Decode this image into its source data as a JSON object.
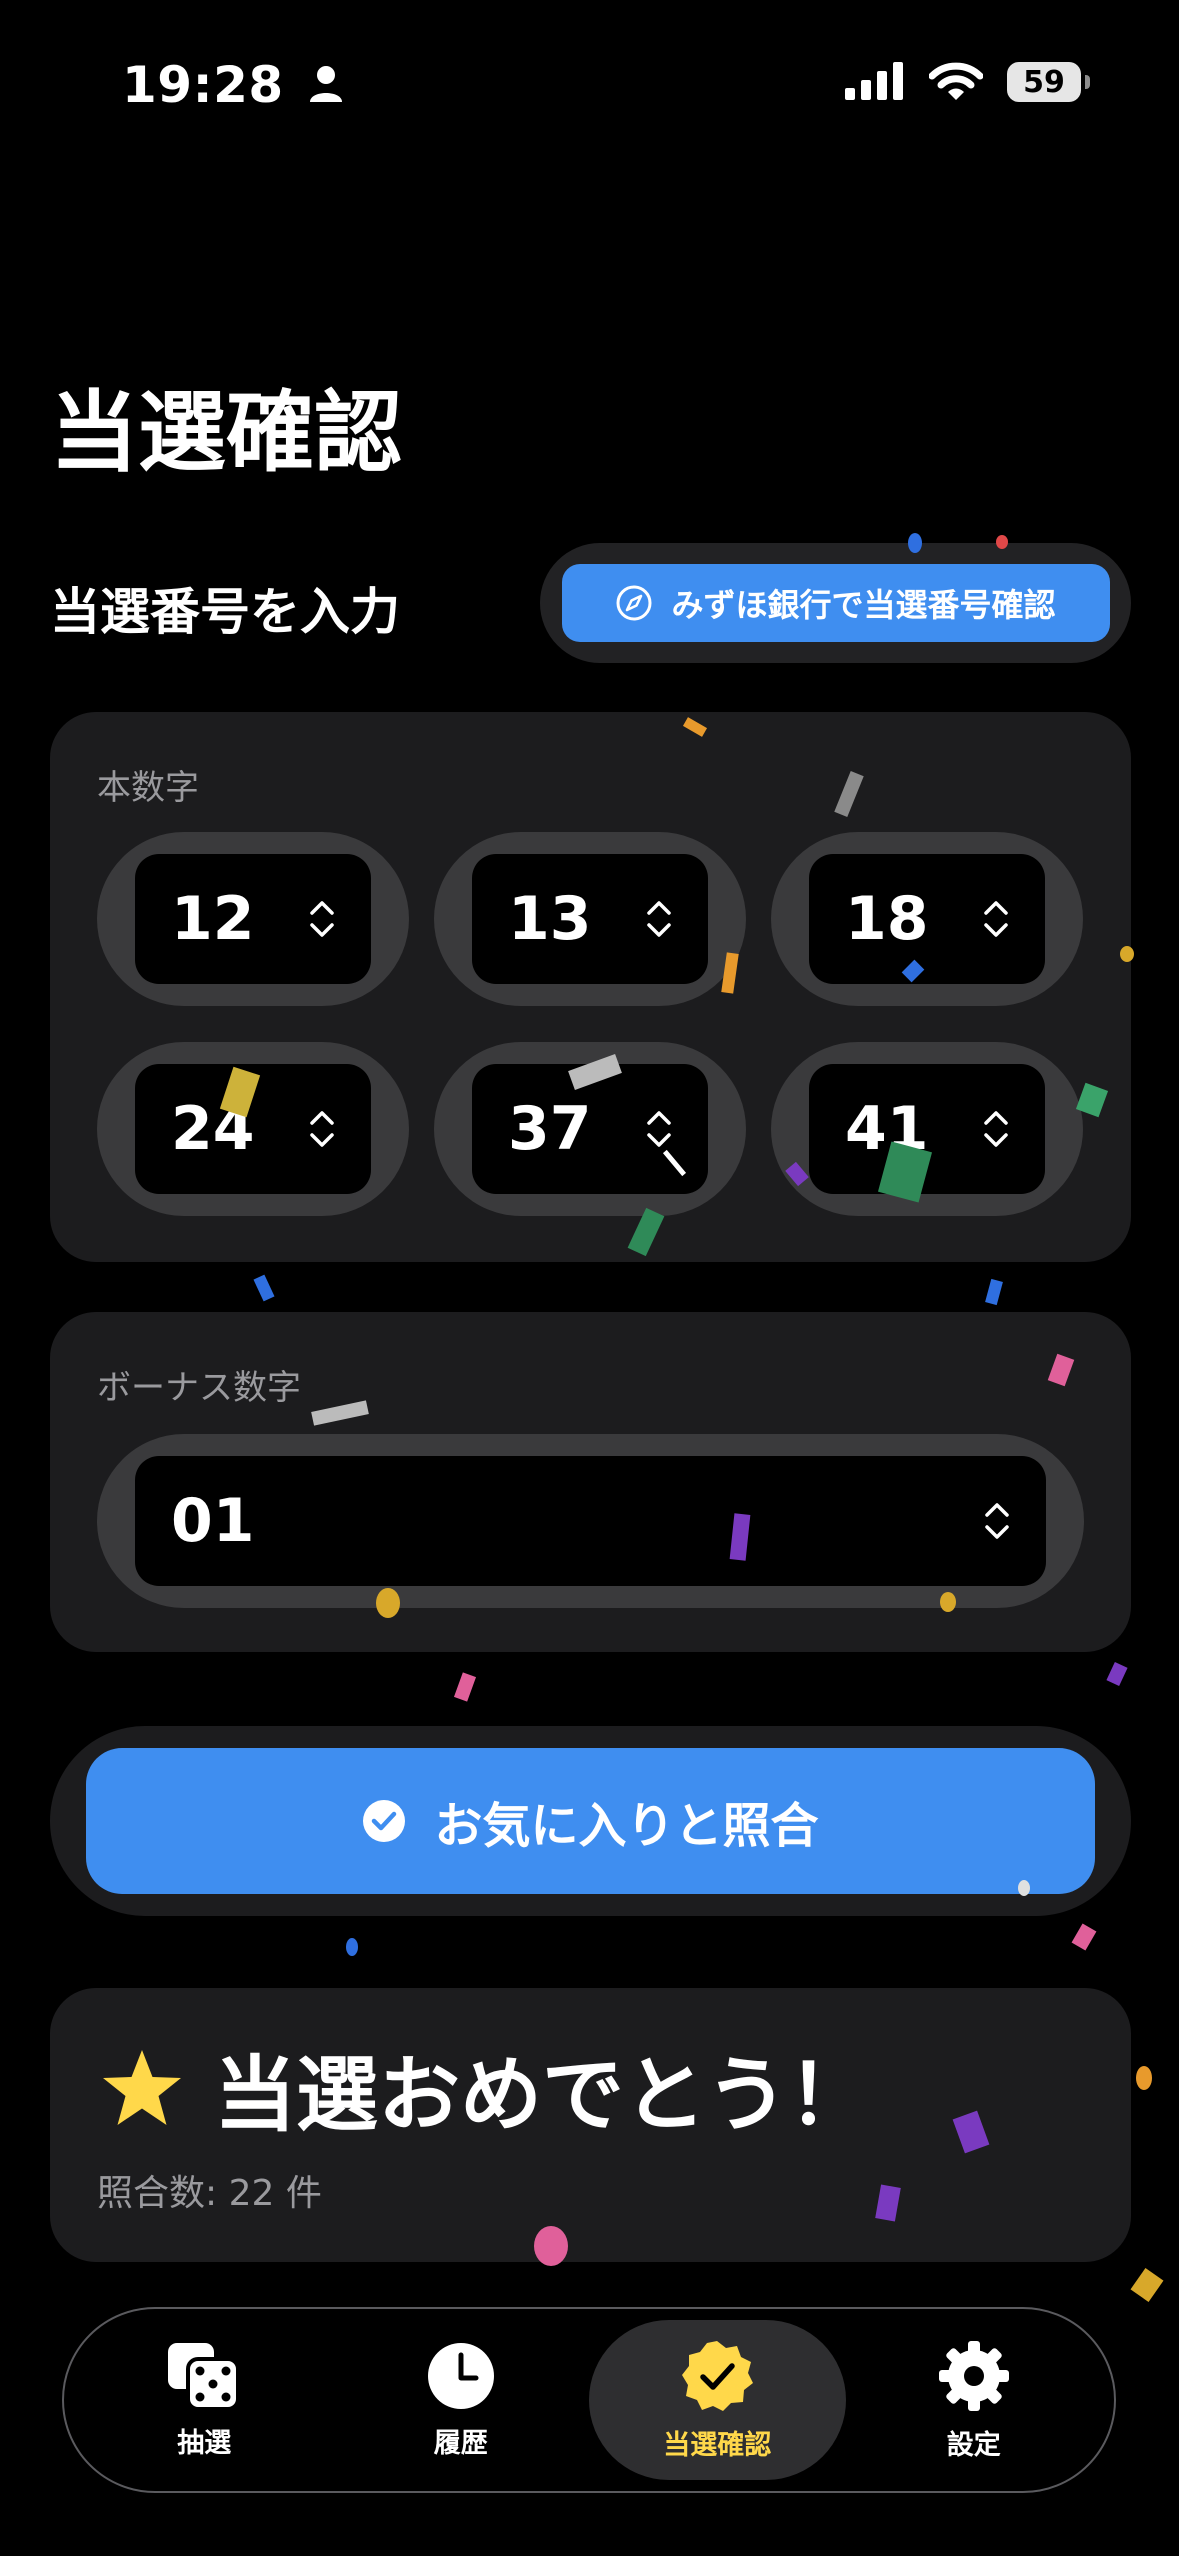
{
  "status_bar": {
    "time": "19:28",
    "battery": "59"
  },
  "page_title": "当選確認",
  "section_label": "当選番号を入力",
  "bank_button_label": "みずほ銀行で当選番号確認",
  "main_numbers": {
    "label": "本数字",
    "values": [
      "12",
      "13",
      "18",
      "24",
      "37",
      "41"
    ]
  },
  "bonus": {
    "label": "ボーナス数字",
    "value": "01"
  },
  "match_button_label": "お気に入りと照合",
  "result": {
    "title": "当選おめでとう！",
    "count_text": "照合数: 22 件"
  },
  "tabs": [
    {
      "label": "抽選",
      "icon": "dice-icon"
    },
    {
      "label": "履歴",
      "icon": "clock-icon"
    },
    {
      "label": "当選確認",
      "icon": "checkmark-seal-icon",
      "active": true
    },
    {
      "label": "設定",
      "icon": "gear-icon"
    }
  ],
  "colors": {
    "accent": "#3f8ef0",
    "active_tab": "#ffd84a",
    "card": "#1c1c1e",
    "star": "#ffd84a"
  }
}
